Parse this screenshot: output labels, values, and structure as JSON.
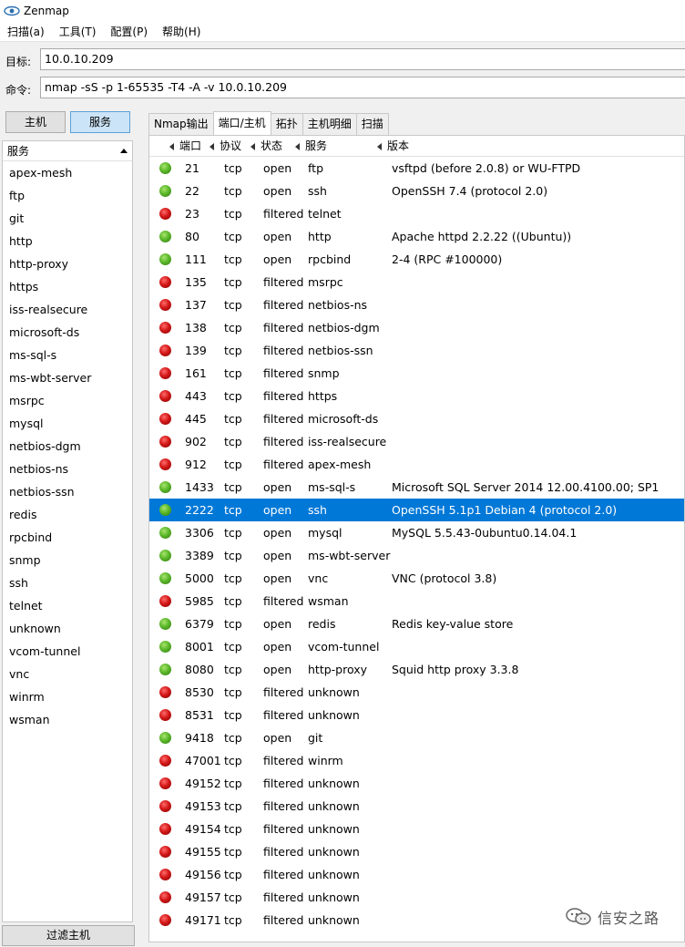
{
  "window": {
    "title": "Zenmap"
  },
  "menu": [
    "扫描(a)",
    "工具(T)",
    "配置(P)",
    "帮助(H)"
  ],
  "target": {
    "label": "目标:",
    "value": "10.0.10.209"
  },
  "command": {
    "label": "命令:",
    "value": "nmap -sS -p 1-65535 -T4 -A -v 10.0.10.209"
  },
  "mode_buttons": {
    "hosts": "主机",
    "services": "服务"
  },
  "left_pane": {
    "header": "服务",
    "services": [
      "apex-mesh",
      "ftp",
      "git",
      "http",
      "http-proxy",
      "https",
      "iss-realsecure",
      "microsoft-ds",
      "ms-sql-s",
      "ms-wbt-server",
      "msrpc",
      "mysql",
      "netbios-dgm",
      "netbios-ns",
      "netbios-ssn",
      "redis",
      "rpcbind",
      "snmp",
      "ssh",
      "telnet",
      "unknown",
      "vcom-tunnel",
      "vnc",
      "winrm",
      "wsman"
    ]
  },
  "filter_button": "过滤主机",
  "tabs": [
    "Nmap输出",
    "端口/主机",
    "拓扑",
    "主机明细",
    "扫描"
  ],
  "active_tab": 1,
  "table": {
    "columns": {
      "port": "端口",
      "protocol": "协议",
      "state": "状态",
      "service": "服务",
      "version": "版本"
    },
    "selected_index": 15,
    "rows": [
      {
        "port": "21",
        "protocol": "tcp",
        "state": "open",
        "service": "ftp",
        "version": "vsftpd (before 2.0.8) or WU-FTPD"
      },
      {
        "port": "22",
        "protocol": "tcp",
        "state": "open",
        "service": "ssh",
        "version": "OpenSSH 7.4 (protocol 2.0)"
      },
      {
        "port": "23",
        "protocol": "tcp",
        "state": "filtered",
        "service": "telnet",
        "version": ""
      },
      {
        "port": "80",
        "protocol": "tcp",
        "state": "open",
        "service": "http",
        "version": "Apache httpd 2.2.22 ((Ubuntu))"
      },
      {
        "port": "111",
        "protocol": "tcp",
        "state": "open",
        "service": "rpcbind",
        "version": "2-4 (RPC #100000)"
      },
      {
        "port": "135",
        "protocol": "tcp",
        "state": "filtered",
        "service": "msrpc",
        "version": ""
      },
      {
        "port": "137",
        "protocol": "tcp",
        "state": "filtered",
        "service": "netbios-ns",
        "version": ""
      },
      {
        "port": "138",
        "protocol": "tcp",
        "state": "filtered",
        "service": "netbios-dgm",
        "version": ""
      },
      {
        "port": "139",
        "protocol": "tcp",
        "state": "filtered",
        "service": "netbios-ssn",
        "version": ""
      },
      {
        "port": "161",
        "protocol": "tcp",
        "state": "filtered",
        "service": "snmp",
        "version": ""
      },
      {
        "port": "443",
        "protocol": "tcp",
        "state": "filtered",
        "service": "https",
        "version": ""
      },
      {
        "port": "445",
        "protocol": "tcp",
        "state": "filtered",
        "service": "microsoft-ds",
        "version": ""
      },
      {
        "port": "902",
        "protocol": "tcp",
        "state": "filtered",
        "service": "iss-realsecure",
        "version": ""
      },
      {
        "port": "912",
        "protocol": "tcp",
        "state": "filtered",
        "service": "apex-mesh",
        "version": ""
      },
      {
        "port": "1433",
        "protocol": "tcp",
        "state": "open",
        "service": "ms-sql-s",
        "version": "Microsoft SQL Server 2014 12.00.4100.00; SP1"
      },
      {
        "port": "2222",
        "protocol": "tcp",
        "state": "open",
        "service": "ssh",
        "version": "OpenSSH 5.1p1 Debian 4 (protocol 2.0)"
      },
      {
        "port": "3306",
        "protocol": "tcp",
        "state": "open",
        "service": "mysql",
        "version": "MySQL 5.5.43-0ubuntu0.14.04.1"
      },
      {
        "port": "3389",
        "protocol": "tcp",
        "state": "open",
        "service": "ms-wbt-server",
        "version": ""
      },
      {
        "port": "5000",
        "protocol": "tcp",
        "state": "open",
        "service": "vnc",
        "version": "VNC (protocol 3.8)"
      },
      {
        "port": "5985",
        "protocol": "tcp",
        "state": "filtered",
        "service": "wsman",
        "version": ""
      },
      {
        "port": "6379",
        "protocol": "tcp",
        "state": "open",
        "service": "redis",
        "version": "Redis key-value store"
      },
      {
        "port": "8001",
        "protocol": "tcp",
        "state": "open",
        "service": "vcom-tunnel",
        "version": ""
      },
      {
        "port": "8080",
        "protocol": "tcp",
        "state": "open",
        "service": "http-proxy",
        "version": "Squid http proxy 3.3.8"
      },
      {
        "port": "8530",
        "protocol": "tcp",
        "state": "filtered",
        "service": "unknown",
        "version": ""
      },
      {
        "port": "8531",
        "protocol": "tcp",
        "state": "filtered",
        "service": "unknown",
        "version": ""
      },
      {
        "port": "9418",
        "protocol": "tcp",
        "state": "open",
        "service": "git",
        "version": ""
      },
      {
        "port": "47001",
        "protocol": "tcp",
        "state": "filtered",
        "service": "winrm",
        "version": ""
      },
      {
        "port": "49152",
        "protocol": "tcp",
        "state": "filtered",
        "service": "unknown",
        "version": ""
      },
      {
        "port": "49153",
        "protocol": "tcp",
        "state": "filtered",
        "service": "unknown",
        "version": ""
      },
      {
        "port": "49154",
        "protocol": "tcp",
        "state": "filtered",
        "service": "unknown",
        "version": ""
      },
      {
        "port": "49155",
        "protocol": "tcp",
        "state": "filtered",
        "service": "unknown",
        "version": ""
      },
      {
        "port": "49156",
        "protocol": "tcp",
        "state": "filtered",
        "service": "unknown",
        "version": ""
      },
      {
        "port": "49157",
        "protocol": "tcp",
        "state": "filtered",
        "service": "unknown",
        "version": ""
      },
      {
        "port": "49171",
        "protocol": "tcp",
        "state": "filtered",
        "service": "unknown",
        "version": ""
      }
    ]
  },
  "watermark": "信安之路",
  "colors": {
    "selection": "#0078d7",
    "open": "#5cb82a",
    "filtered": "#d41818"
  }
}
